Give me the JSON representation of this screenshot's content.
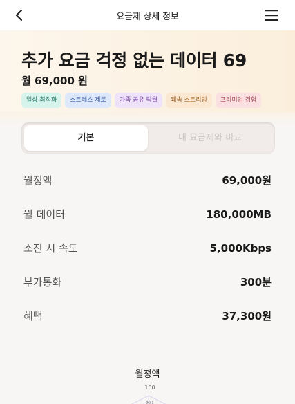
{
  "header": {
    "title": "요금제 상세 정보",
    "back_icon": "back-arrow-icon",
    "menu_icon": "hamburger-menu-icon"
  },
  "plan": {
    "name": "추가 요금 걱정 없는 데이터 69",
    "price": "월 69,000 원",
    "tags": [
      {
        "label": "일상 최적화",
        "bg": "#d6f3ec",
        "color": "#2b7f6d"
      },
      {
        "label": "스트레스 제로",
        "bg": "#dde8fa",
        "color": "#3f63a8"
      },
      {
        "label": "가족 공유 탁월",
        "bg": "#efe3fa",
        "color": "#7a4aa3"
      },
      {
        "label": "쾌속 스트리밍",
        "bg": "#fbe8d2",
        "color": "#a86a2c"
      },
      {
        "label": "프리미엄 경험",
        "bg": "#fbe0e2",
        "color": "#a84855"
      }
    ]
  },
  "tabs": {
    "basic": "기본",
    "compare": "내 요금제와 비교"
  },
  "details": [
    {
      "label": "월정액",
      "value": "69,000원"
    },
    {
      "label": "월 데이터",
      "value": "180,000MB"
    },
    {
      "label": "소진 시 속도",
      "value": "5,000Kbps"
    },
    {
      "label": "부가통화",
      "value": "300분"
    },
    {
      "label": "혜택",
      "value": "37,300원"
    }
  ],
  "radar": {
    "axis_top_label": "월정액",
    "tick_max": "100",
    "tick_next": "80",
    "grid_color": "#d9d2ee"
  }
}
